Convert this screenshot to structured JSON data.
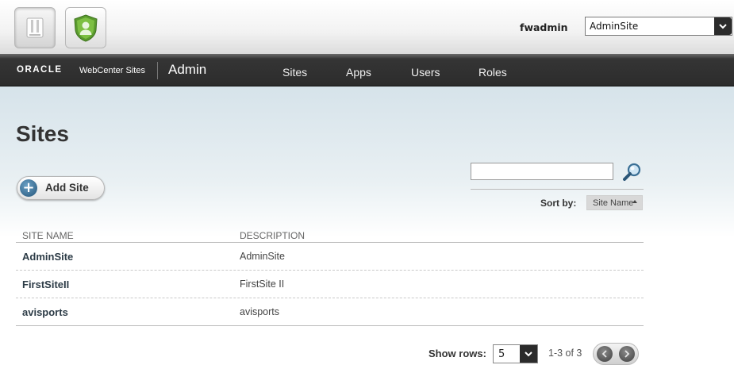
{
  "header": {
    "user": "fwadmin",
    "site_select": {
      "value": "AdminSite"
    },
    "app_icons": [
      "admin-app-icon",
      "contributor-app-icon"
    ]
  },
  "nav": {
    "brand": "ORACLE",
    "product": "WebCenter Sites",
    "section": "Admin",
    "links": [
      "Sites",
      "Apps",
      "Users",
      "Roles"
    ]
  },
  "page": {
    "title": "Sites",
    "add_button": "Add Site",
    "search": {
      "value": "",
      "icon": "magnifier-icon"
    },
    "sort_label": "Sort by:",
    "sort_value": "Site Name"
  },
  "table": {
    "headers": [
      "SITE NAME",
      "DESCRIPTION"
    ],
    "rows": [
      {
        "name": "AdminSite",
        "description": "AdminSite"
      },
      {
        "name": "FirstSiteII",
        "description": "FirstSite II"
      },
      {
        "name": "avisports",
        "description": "avisports"
      }
    ]
  },
  "pager": {
    "show_rows_label": "Show rows:",
    "rows_value": "5",
    "range": "1-3 of 3"
  },
  "colors": {
    "navbar": "#2c2c2c",
    "content_gradient_top": "#d6e3ea",
    "add_icon": "#24557a",
    "contributor_icon": "#5a9a2e"
  }
}
